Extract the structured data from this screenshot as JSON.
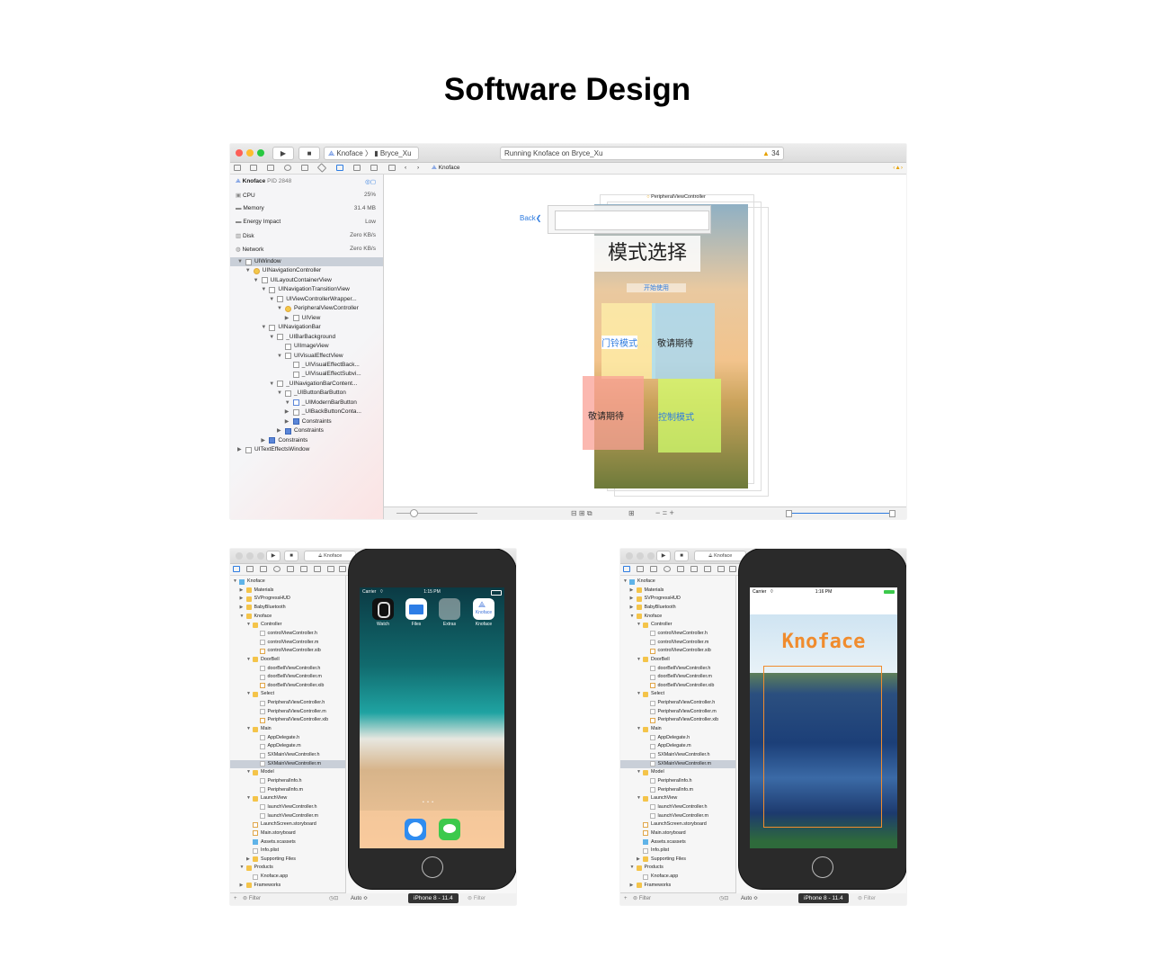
{
  "page": {
    "title": "Software Design"
  },
  "window1": {
    "scheme": "Knoface",
    "device": "Bryce_Xu",
    "status_text": "Running Knoface on Bryce_Xu",
    "warning_count": "34",
    "jump_bar": "Knoface",
    "debug": {
      "process": "Knoface",
      "pid": "PID 2848",
      "gauges": [
        {
          "label": "CPU",
          "value": "25%"
        },
        {
          "label": "Memory",
          "value": "31.4 MB"
        },
        {
          "label": "Energy Impact",
          "value": "Low"
        },
        {
          "label": "Disk",
          "value": "Zero KB/s"
        },
        {
          "label": "Network",
          "value": "Zero KB/s"
        }
      ]
    },
    "hierarchy": [
      "UIWindow",
      "UINavigationController",
      "UILayoutContainerView",
      "UINavigationTransitionView",
      "UIViewControllerWrapper...",
      "PeripheralViewController",
      "UIView",
      "UINavigationBar",
      "_UIBarBackground",
      "UIImageView",
      "UIVisualEffectView",
      "_UIVisualEffectBack...",
      "_UIVisualEffectSubvi...",
      "_UINavigationBarContent...",
      "_UIButtonBarButton",
      "_UIModernBarButton",
      "_UIBackButtonConta...",
      "Constraints",
      "Constraints",
      "Constraints",
      "UITextEffectsWindow"
    ],
    "canvas": {
      "controller_label": "PeripheralViewController",
      "back_label": "Back",
      "heading": "模式选择",
      "start_label": "开始使用",
      "tiles": [
        "门铃模式",
        "敬请期待",
        "敬请期待",
        "控制模式"
      ]
    }
  },
  "window2": {
    "scheme": "Knoface",
    "device_badge": "iPhone 8 - 11.4",
    "filter_placeholder": "Filter",
    "auto_label": "Auto ≎",
    "carrier": "Carrier",
    "time": "1:15 PM",
    "apps": [
      {
        "name": "Watch",
        "icon": "watch-app-icon"
      },
      {
        "name": "Files",
        "icon": "files-app-icon"
      },
      {
        "name": "Extras",
        "icon": "extras-folder-icon"
      },
      {
        "name": "Knoface",
        "icon": "knoface-app-icon"
      }
    ],
    "knoface_icon_text": "Knoface"
  },
  "window3": {
    "scheme": "Knoface",
    "device_badge": "iPhone 8 - 11.4",
    "filter_placeholder": "Filter",
    "auto_label": "Auto ≎",
    "carrier": "Carrier",
    "time": "1:16 PM",
    "app_title": "Knoface"
  },
  "navigator_files": [
    {
      "name": "Knoface",
      "kind": "proj",
      "depth": 0
    },
    {
      "name": "Materials",
      "kind": "folder",
      "depth": 1
    },
    {
      "name": "SVProgressHUD",
      "kind": "folder",
      "depth": 1
    },
    {
      "name": "BabyBluetooth",
      "kind": "folder",
      "depth": 1
    },
    {
      "name": "Knoface",
      "kind": "folder",
      "depth": 1
    },
    {
      "name": "Controller",
      "kind": "folder",
      "depth": 2
    },
    {
      "name": "controlViewController.h",
      "kind": "h",
      "depth": 3
    },
    {
      "name": "controlViewController.m",
      "kind": "m",
      "depth": 3
    },
    {
      "name": "controlViewController.xib",
      "kind": "xib",
      "depth": 3
    },
    {
      "name": "DoorBell",
      "kind": "folder",
      "depth": 2
    },
    {
      "name": "doorBellViewController.h",
      "kind": "h",
      "depth": 3
    },
    {
      "name": "doorBellViewController.m",
      "kind": "m",
      "depth": 3
    },
    {
      "name": "doorBellViewController.xib",
      "kind": "xib",
      "depth": 3
    },
    {
      "name": "Select",
      "kind": "folder",
      "depth": 2
    },
    {
      "name": "PeripheralViewController.h",
      "kind": "h",
      "depth": 3
    },
    {
      "name": "PeripheralViewController.m",
      "kind": "m",
      "depth": 3
    },
    {
      "name": "PeripheralViewController.xib",
      "kind": "xib",
      "depth": 3
    },
    {
      "name": "Main",
      "kind": "folder",
      "depth": 2
    },
    {
      "name": "AppDelegate.h",
      "kind": "h",
      "depth": 3
    },
    {
      "name": "AppDelegate.m",
      "kind": "m",
      "depth": 3
    },
    {
      "name": "SXMainViewController.h",
      "kind": "h",
      "depth": 3
    },
    {
      "name": "SXMainViewController.m",
      "kind": "m",
      "depth": 3,
      "selected": true
    },
    {
      "name": "Model",
      "kind": "folder",
      "depth": 2
    },
    {
      "name": "PeripheralInfo.h",
      "kind": "h",
      "depth": 3
    },
    {
      "name": "PeripheralInfo.m",
      "kind": "m",
      "depth": 3
    },
    {
      "name": "LaunchView",
      "kind": "folder",
      "depth": 2
    },
    {
      "name": "launchViewController.h",
      "kind": "h",
      "depth": 3
    },
    {
      "name": "launchViewController.m",
      "kind": "m",
      "depth": 3
    },
    {
      "name": "LaunchScreen.storyboard",
      "kind": "xib",
      "depth": 2
    },
    {
      "name": "Main.storyboard",
      "kind": "xib",
      "depth": 2
    },
    {
      "name": "Assets.xcassets",
      "kind": "assets",
      "depth": 2
    },
    {
      "name": "Info.plist",
      "kind": "h",
      "depth": 2
    },
    {
      "name": "Supporting Files",
      "kind": "folder",
      "depth": 2
    },
    {
      "name": "Products",
      "kind": "folder",
      "depth": 1
    },
    {
      "name": "Knoface.app",
      "kind": "h",
      "depth": 2
    },
    {
      "name": "Frameworks",
      "kind": "folder",
      "depth": 1
    }
  ]
}
